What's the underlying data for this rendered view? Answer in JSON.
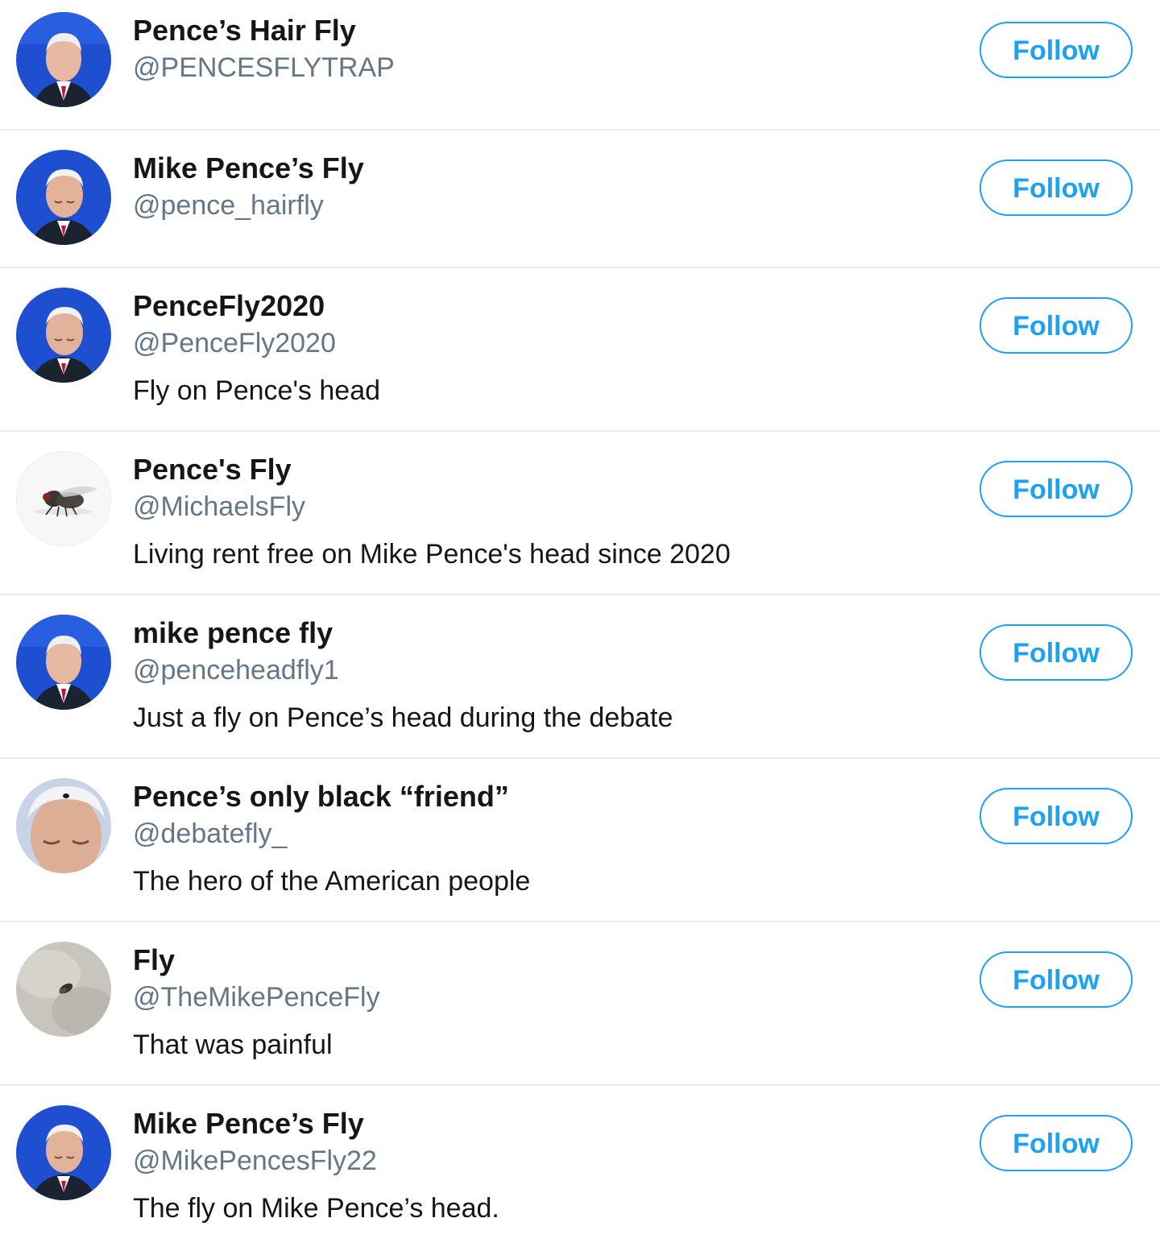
{
  "accounts": [
    {
      "name": "Pence’s Hair Fly",
      "handle": "@PENCESFLYTRAP",
      "bio": "",
      "follow_label": "Follow",
      "avatar": "portrait-blue-bg"
    },
    {
      "name": "Mike Pence’s Fly",
      "handle": "@pence_hairfly",
      "bio": "",
      "follow_label": "Follow",
      "avatar": "portrait-head-down"
    },
    {
      "name": "PenceFly2020",
      "handle": "@PenceFly2020",
      "bio": "Fly on Pence's head",
      "follow_label": "Follow",
      "avatar": "portrait-head-down"
    },
    {
      "name": "Pence's Fly",
      "handle": "@MichaelsFly",
      "bio": "Living rent free on Mike Pence's head since 2020",
      "follow_label": "Follow",
      "avatar": "fly-photo"
    },
    {
      "name": "mike pence fly",
      "handle": "@penceheadfly1",
      "bio": "Just a fly on Pence’s head during the debate",
      "follow_label": "Follow",
      "avatar": "portrait-blue-bg"
    },
    {
      "name": "Pence’s only black “friend”",
      "handle": "@debatefly_",
      "bio": "The hero of the American people",
      "follow_label": "Follow",
      "avatar": "closeup-hair-fly"
    },
    {
      "name": "Fly",
      "handle": "@TheMikePenceFly",
      "bio": "That was painful",
      "follow_label": "Follow",
      "avatar": "fly-on-grey-hair"
    },
    {
      "name": "Mike Pence’s Fly",
      "handle": "@MikePencesFly22",
      "bio": "The fly on Mike Pence’s head.",
      "follow_label": "Follow",
      "avatar": "portrait-head-down"
    }
  ],
  "colors": {
    "accent": "#1da1f2",
    "name_text": "#14171a",
    "handle_text": "#657786",
    "divider": "#e6ecf0",
    "avatar_blue": "#1f4fd1"
  }
}
